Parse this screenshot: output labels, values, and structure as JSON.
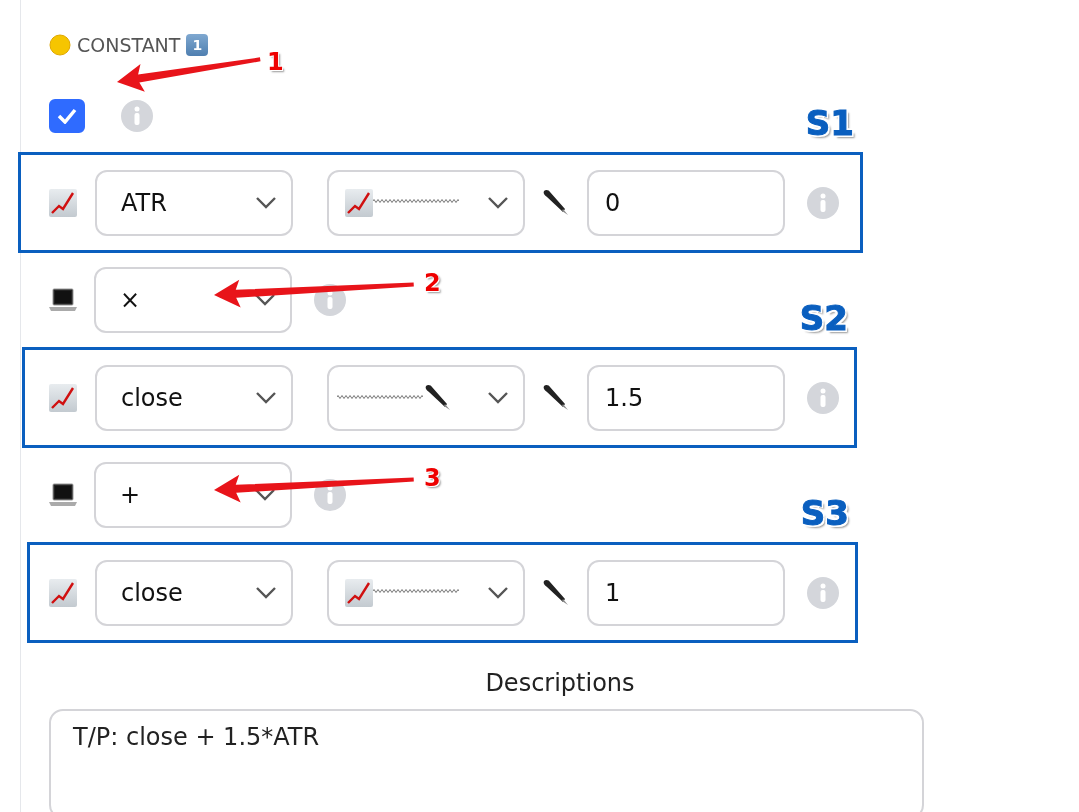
{
  "header": {
    "title": "CONSTANT",
    "badge": "1"
  },
  "enabled": {
    "checked": true,
    "callout": "1"
  },
  "rows": [
    {
      "kind": "series",
      "source": "ATR",
      "value": "0",
      "tag": "S1"
    },
    {
      "kind": "operator",
      "symbol": "×",
      "callout": "2"
    },
    {
      "kind": "series",
      "source": "close",
      "value": "1.5",
      "tag": "S2"
    },
    {
      "kind": "operator",
      "symbol": "+",
      "callout": "3"
    },
    {
      "kind": "series",
      "source": "close",
      "value": "1",
      "tag": "S3"
    }
  ],
  "descriptions": {
    "title": "Descriptions",
    "value": "T/P: close + 1.5*ATR"
  }
}
